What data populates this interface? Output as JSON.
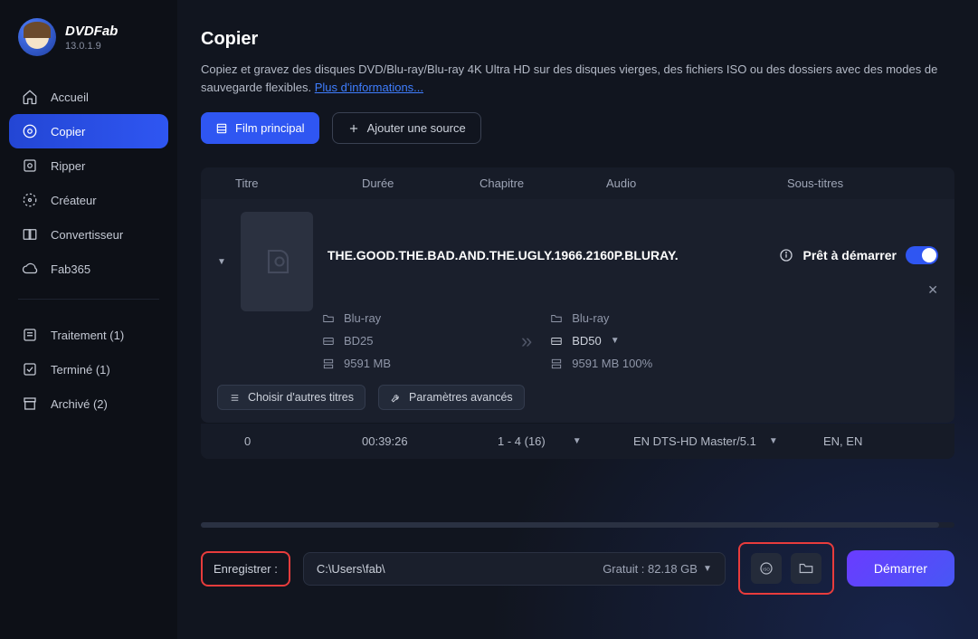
{
  "brand": {
    "name": "DVDFab",
    "version": "13.0.1.9"
  },
  "sidebar": {
    "items": [
      {
        "label": "Accueil"
      },
      {
        "label": "Copier"
      },
      {
        "label": "Ripper"
      },
      {
        "label": "Créateur"
      },
      {
        "label": "Convertisseur"
      },
      {
        "label": "Fab365"
      }
    ],
    "queue": [
      {
        "label": "Traitement (1)"
      },
      {
        "label": "Terminé (1)"
      },
      {
        "label": "Archivé (2)"
      }
    ]
  },
  "page": {
    "title": "Copier",
    "description": "Copiez et gravez des disques DVD/Blu-ray/Blu-ray 4K Ultra HD sur des disques vierges, des fichiers ISO ou des dossiers avec des modes de sauvegarde flexibles. ",
    "more_link": "Plus d'informations..."
  },
  "toolbar": {
    "main_film": "Film principal",
    "add_source": "Ajouter une source"
  },
  "columns": {
    "title": "Titre",
    "duration": "Durée",
    "chapter": "Chapitre",
    "audio": "Audio",
    "subtitles": "Sous-titres"
  },
  "task": {
    "title": "THE.GOOD.THE.BAD.AND.THE.UGLY.1966.2160P.BLURAY.",
    "status": "Prêt à démarrer",
    "source": {
      "type": "Blu-ray",
      "disc": "BD25",
      "size": "9591 MB"
    },
    "target": {
      "type": "Blu-ray",
      "disc": "BD50",
      "size": "9591 MB 100%"
    },
    "choose_other": "Choisir d'autres titres",
    "adv_settings": "Paramètres avancés"
  },
  "footer_row": {
    "index": "0",
    "duration": "00:39:26",
    "chapters": "1 - 4 (16)",
    "audio": "EN  DTS-HD Master/5.1",
    "subs": "EN, EN"
  },
  "bottom": {
    "save_label": "Enregistrer :",
    "path": "C:\\Users\\fab\\",
    "free": "Gratuit : 82.18 GB",
    "start": "Démarrer"
  }
}
